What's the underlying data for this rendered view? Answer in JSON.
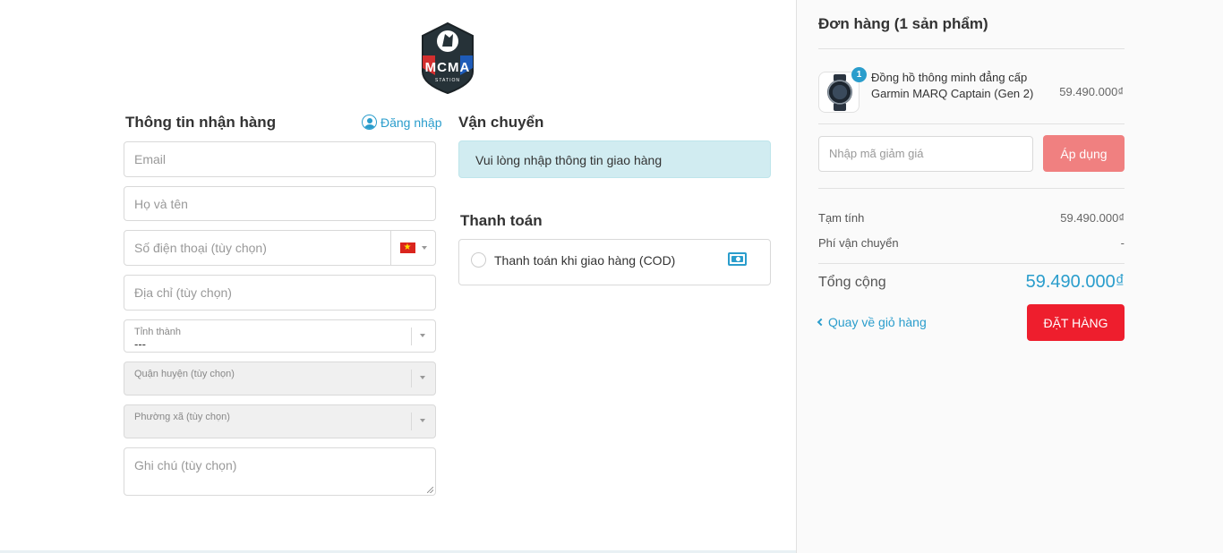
{
  "brand": {
    "logo_text": "MCMA",
    "logo_subtext": "STATION"
  },
  "customer": {
    "title": "Thông tin nhận hàng",
    "login_label": "Đăng nhập",
    "email_placeholder": "Email",
    "name_placeholder": "Họ và tên",
    "phone_placeholder": "Số điện thoại (tùy chọn)",
    "address_placeholder": "Địa chỉ (tùy chọn)",
    "province_label": "Tỉnh thành",
    "province_value": "---",
    "district_label": "Quận huyện (tùy chọn)",
    "ward_label": "Phường xã (tùy chọn)",
    "note_placeholder": "Ghi chú (tùy chọn)"
  },
  "shipping": {
    "title": "Vận chuyển",
    "notice": "Vui lòng nhập thông tin giao hàng"
  },
  "payment": {
    "title": "Thanh toán",
    "cod_label": "Thanh toán khi giao hàng (COD)"
  },
  "order": {
    "title": "Đơn hàng (1 sản phẩm)",
    "item": {
      "qty": "1",
      "name": "Đồng hồ thông minh đẳng cấp Garmin MARQ Captain (Gen 2)",
      "price": "59.490.000₫"
    },
    "discount_placeholder": "Nhập mã giảm giá",
    "apply_label": "Áp dụng",
    "subtotal_label": "Tạm tính",
    "subtotal_value": "59.490.000₫",
    "shipping_fee_label": "Phí vận chuyển",
    "shipping_fee_value": "-",
    "total_label": "Tổng cộng",
    "total_value": "59.490.000₫",
    "back_label": "Quay về giỏ hàng",
    "place_order_label": "ĐẶT HÀNG"
  },
  "colors": {
    "accent": "#2a9dcc",
    "order_button": "#ee1e2d",
    "apply_button": "#f08080",
    "notice_bg": "#d1ecf1"
  }
}
